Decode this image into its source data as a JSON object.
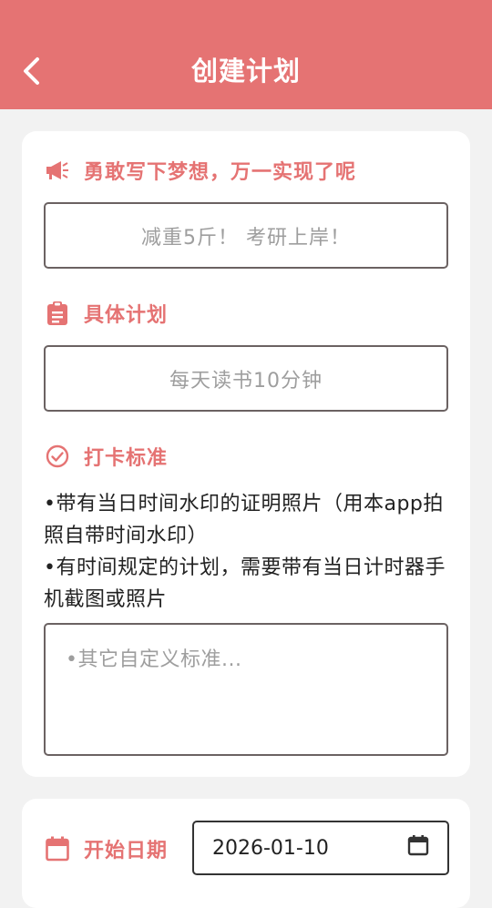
{
  "header": {
    "title": "创建计划",
    "back_icon": "chevron-left-icon"
  },
  "colors": {
    "accent": "#e57373",
    "background": "#f2f2f2",
    "card": "#ffffff",
    "placeholder": "#9e9e9e"
  },
  "dream": {
    "icon": "megaphone-icon",
    "label": "勇敢写下梦想，万一实现了呢",
    "placeholder": "减重5斤！ 考研上岸！"
  },
  "plan": {
    "icon": "clipboard-icon",
    "label": "具体计划",
    "placeholder": "每天读书10分钟"
  },
  "checkin": {
    "icon": "check-circle-icon",
    "label": "打卡标准",
    "rule_1": "•带有当日时间水印的证明照片（用本app拍照自带时间水印）",
    "rule_2": "•有时间规定的计划，需要带有当日计时器手机截图或照片",
    "custom_placeholder": "•其它自定义标准..."
  },
  "start_date": {
    "icon": "calendar-icon",
    "label": "开始日期",
    "value": "2026-01-10",
    "picker_icon": "calendar-icon"
  }
}
